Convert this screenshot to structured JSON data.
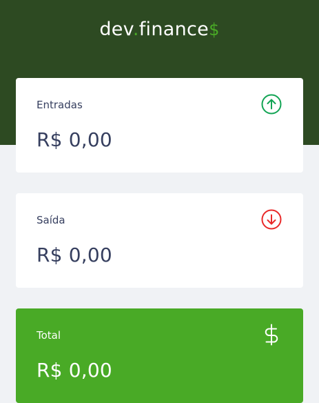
{
  "header": {
    "logo_part1": "dev",
    "logo_dot": ".",
    "logo_part2": "finance",
    "logo_dollar": "$"
  },
  "cards": {
    "income": {
      "label": "Entradas",
      "value": "R$ 0,00",
      "icon": "arrow-up-circle-icon",
      "color": "#12a454"
    },
    "expense": {
      "label": "Saída",
      "value": "R$ 0,00",
      "icon": "arrow-down-circle-icon",
      "color": "#e92929"
    },
    "total": {
      "label": "Total",
      "value": "R$ 0,00",
      "icon": "dollar-sign-icon",
      "color": "#ffffff"
    }
  },
  "colors": {
    "header_bg": "#2d4a22",
    "accent": "#49aa26",
    "page_bg": "#f0f2f5",
    "text": "#363f5f"
  }
}
